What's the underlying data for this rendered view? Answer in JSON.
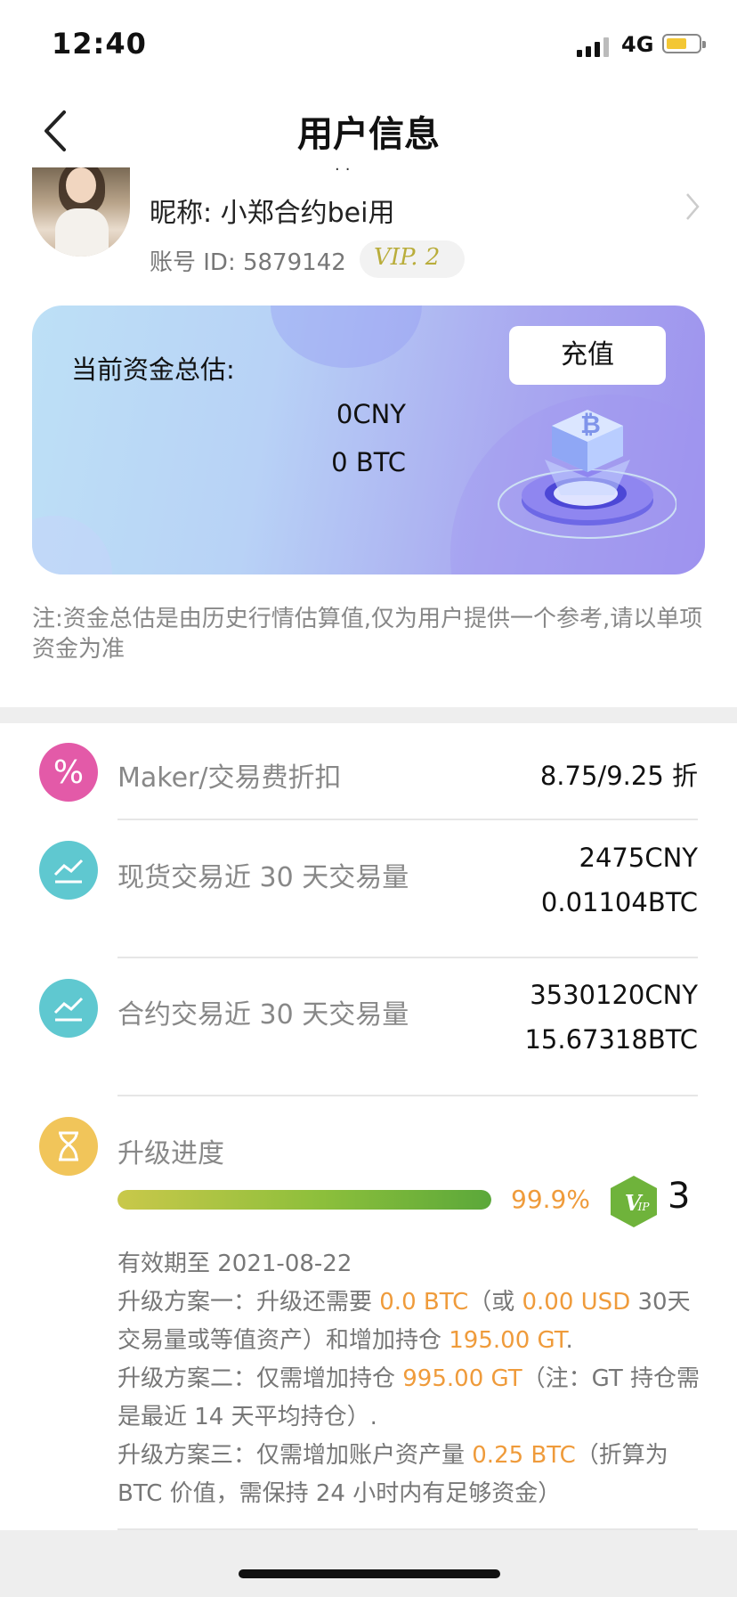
{
  "status_bar": {
    "time": "12:40",
    "network": "4G"
  },
  "header": {
    "title": "用户信息"
  },
  "profile": {
    "nickname": "昵称: 小郑合约bei用",
    "account_id": "账号 ID: 5879142",
    "vip_badge": "VIP. 2"
  },
  "asset_card": {
    "label": "当前资金总估:",
    "recharge_label": "充值",
    "cny": "0CNY",
    "btc": "0 BTC"
  },
  "asset_note": "注:资金总估是由历史行情估算值,仅为用户提供一个参考,请以单项资金为准",
  "rows": [
    {
      "label": "Maker/交易费折扣",
      "values": [
        "8.75/9.25 折"
      ],
      "icon": "percent-icon",
      "icon_color": "#e35aa8"
    },
    {
      "label": "现货交易近 30 天交易量",
      "values": [
        "2475CNY",
        "0.01104BTC"
      ],
      "icon": "trend-icon",
      "icon_color": "#5fc8d0"
    },
    {
      "label": "合约交易近 30 天交易量",
      "values": [
        "3530120CNY",
        "15.67318BTC"
      ],
      "icon": "trend-icon",
      "icon_color": "#5fc8d0"
    }
  ],
  "upgrade": {
    "label": "升级进度",
    "icon": "hourglass-icon",
    "icon_color": "#f1c55a",
    "progress": 0.999,
    "percent_text": "99.9%",
    "next_level": "3",
    "valid_until": "有效期至 2021-08-22",
    "plan1": {
      "a": "升级方案一：升级还需要 ",
      "b": "0.0 BTC",
      "c": "（或 ",
      "d": "0.00 USD",
      "e": " 30天交易量或等值资产）和增加持仓 ",
      "f": "195.00 GT",
      "g": "."
    },
    "plan2": {
      "a": "升级方案二：仅需增加持仓 ",
      "b": "995.00 GT",
      "c": "（注：GT 持仓需是最近 14 天平均持仓）."
    },
    "plan3": {
      "a": "升级方案三：仅需增加账户资产量 ",
      "b": "0.25 BTC",
      "c": "（折算为 BTC 价值，需保持 24 小时内有足够资金）"
    }
  },
  "colors": {
    "accent_orange": "#ef9b3b",
    "vip_green": "#6fb33b"
  }
}
